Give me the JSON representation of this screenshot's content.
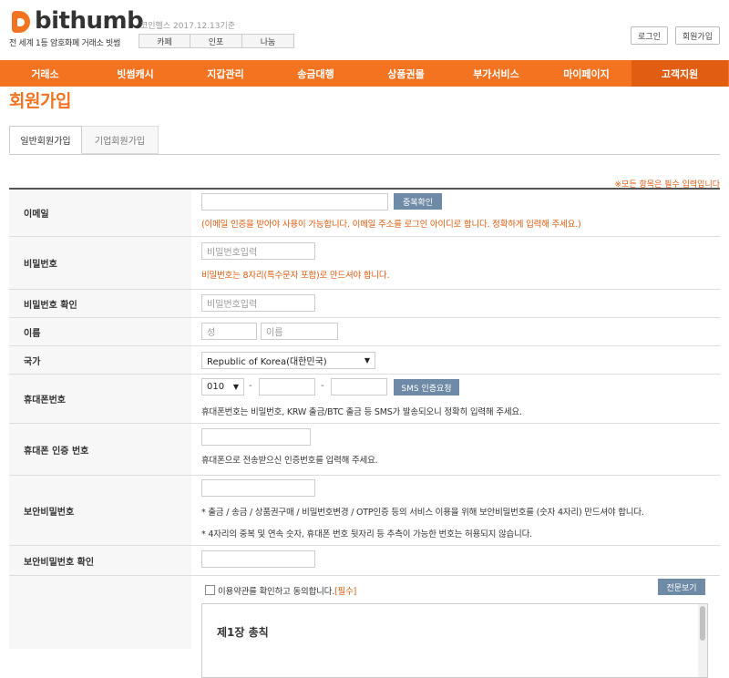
{
  "header": {
    "brand": "bithumb",
    "slogan": "전 세계 1등 암호화폐 거래소 빗썸",
    "coin_health": "코인헬스 2017.12.13기준",
    "sub_tabs": [
      "카페",
      "인포",
      "나눔"
    ],
    "login": "로그인",
    "signup": "회원가입"
  },
  "nav": {
    "items": [
      "거래소",
      "빗썸캐시",
      "지갑관리",
      "송금대행",
      "상품권몰",
      "부가서비스",
      "마이페이지",
      "고객지원"
    ],
    "active_index": 7,
    "bg_color": "#f37321",
    "active_color": "#e05d12"
  },
  "page_title": "회원가입",
  "tabs": [
    "일반회원가입",
    "기업회원가입"
  ],
  "required_note": "※모든 항목은 필수 입력입니다",
  "form": {
    "email": {
      "label": "이메일",
      "check_button": "중복확인",
      "note": "(이메일 인증을 받아야 사용이 가능합니다. 이메일 주소를 로그인 아이디로 합니다. 정확하게 입력해 주세요.)"
    },
    "password": {
      "label": "비밀번호",
      "placeholder": "비밀번호입력",
      "note": "비밀번호는 8자리(특수문자 포함)로 만드셔야 합니다."
    },
    "password_confirm": {
      "label": "비밀번호 확인",
      "placeholder": "비밀번호입력"
    },
    "name": {
      "label": "이름",
      "last_placeholder": "성",
      "first_placeholder": "이름"
    },
    "country": {
      "label": "국가",
      "value": "Republic of Korea(대한민국)"
    },
    "phone": {
      "label": "휴대폰번호",
      "prefix": "010",
      "sms_button": "SMS 인증요청",
      "note": "휴대폰번호는 비밀번호, KRW 출금/BTC 출금 등 SMS가 발송되오니 정확히 입력해 주세요."
    },
    "phone_auth": {
      "label": "휴대폰 인증 번호",
      "note": "휴대폰으로 전송받으신 인증번호를 입력해 주세요."
    },
    "security_pw": {
      "label": "보안비밀번호",
      "note1": "* 출금 / 송금 / 상품권구매 / 비밀번호변경 / OTP인증 등의 서비스 이용을 위해 보안비밀번호를 (숫자 4자리) 만드셔야 합니다.",
      "note2": "* 4자리의 중복 및 연속 숫자, 휴대폰 번호 뒷자리 등 추측이 가능한 번호는 허용되지 않습니다."
    },
    "security_pw_confirm": {
      "label": "보안비밀번호 확인"
    },
    "terms": {
      "agree_text": "이용약관를 확인하고 동의합니다.",
      "required_tag": "[필수]",
      "view_button": "전문보기",
      "chapter_title": "제1장 총칙"
    }
  }
}
